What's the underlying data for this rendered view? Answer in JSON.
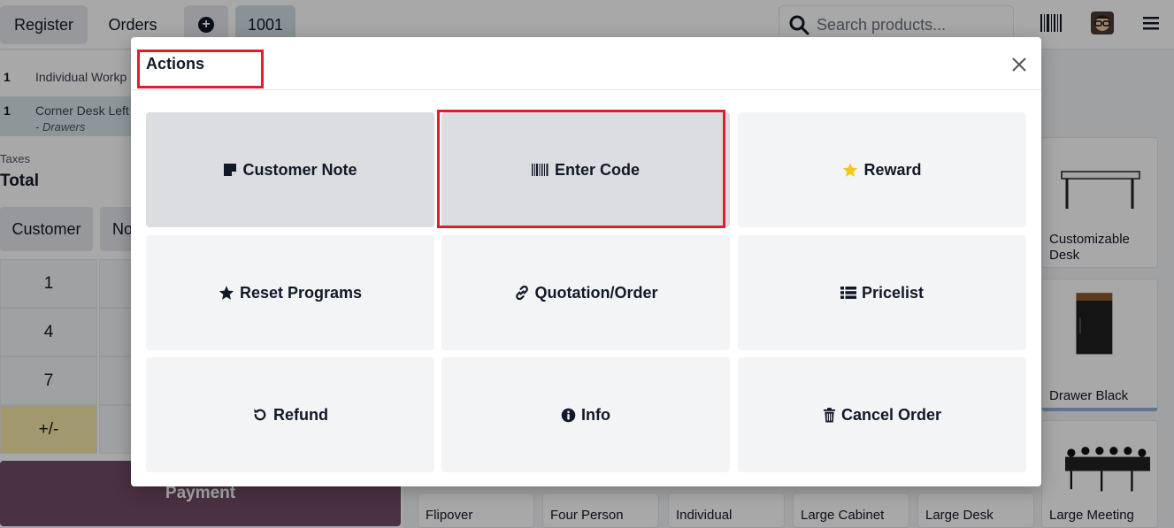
{
  "topbar": {
    "register_label": "Register",
    "orders_label": "Orders",
    "order_number": "1001",
    "search_placeholder": "Search products..."
  },
  "order": {
    "lines": [
      {
        "qty": "1",
        "name": "Individual Workp"
      },
      {
        "qty": "1",
        "name": "Corner Desk Left",
        "variant": "- Drawers"
      }
    ],
    "taxes_label": "Taxes",
    "total_label": "Total"
  },
  "controls": {
    "customer_label": "Customer",
    "note_label_partial": "No",
    "numpad": [
      "1",
      "4",
      "7",
      "+/-"
    ],
    "payment_label": "Payment"
  },
  "products": [
    {
      "name": "Customizable Desk"
    },
    {
      "name": "Drawer Black"
    },
    {
      "name": "Flipover"
    },
    {
      "name": "Four Person"
    },
    {
      "name": "Individual"
    },
    {
      "name": "Large Cabinet"
    },
    {
      "name": "Large Desk"
    },
    {
      "name": "Large Meeting"
    }
  ],
  "modal": {
    "title": "Actions",
    "actions": [
      {
        "label": "Customer Note",
        "icon": "sticky-note-icon"
      },
      {
        "label": "Enter Code",
        "icon": "barcode-icon"
      },
      {
        "label": "Reward",
        "icon": "star-icon",
        "icon_color": "#f5c518"
      },
      {
        "label": "Reset Programs",
        "icon": "star-icon"
      },
      {
        "label": "Quotation/Order",
        "icon": "link-icon"
      },
      {
        "label": "Pricelist",
        "icon": "list-icon"
      },
      {
        "label": "Refund",
        "icon": "undo-icon"
      },
      {
        "label": "Info",
        "icon": "info-icon"
      },
      {
        "label": "Cancel Order",
        "icon": "trash-icon"
      }
    ]
  },
  "colors": {
    "highlight": "#e11d2e",
    "payment": "#714b67",
    "selected_line": "#d7e6ea"
  }
}
